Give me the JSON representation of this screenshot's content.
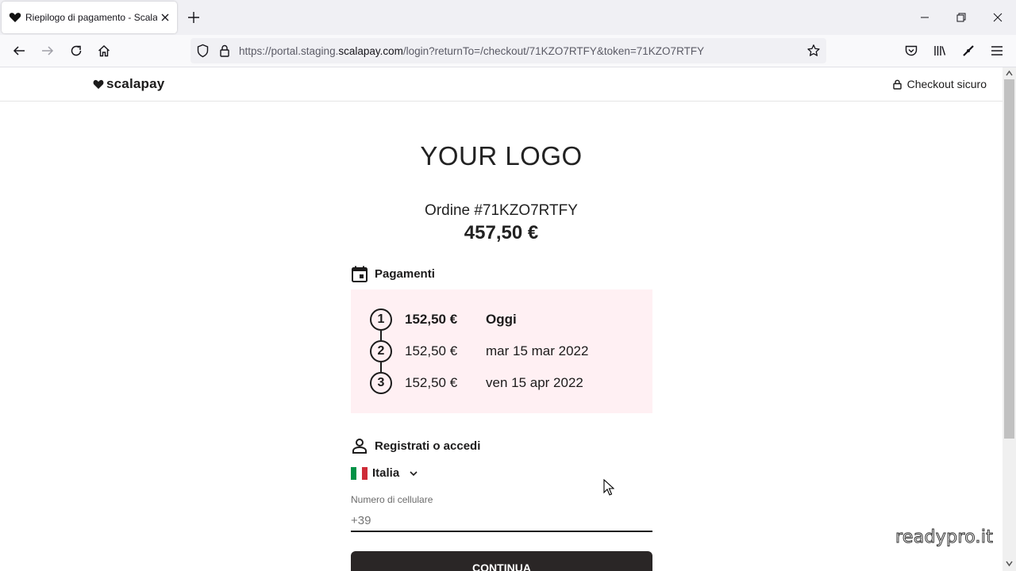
{
  "browser": {
    "tab_title": "Riepilogo di pagamento - Scalapay",
    "url_prefix": "https://portal.staging.",
    "url_host": "scalapay.com",
    "url_path": "/login?returnTo=/checkout/71KZO7RTFY&token=71KZO7RTFY"
  },
  "header": {
    "brand": "scalapay",
    "secure_label": "Checkout sicuro"
  },
  "merchant": {
    "logo_text": "YOUR LOGO"
  },
  "order": {
    "label": "Ordine #71KZO7RTFY",
    "total": "457,50 €"
  },
  "payments": {
    "title": "Pagamenti",
    "installments": [
      {
        "number": "1",
        "amount": "152,50 €",
        "date": "Oggi"
      },
      {
        "number": "2",
        "amount": "152,50 €",
        "date": "mar 15 mar 2022"
      },
      {
        "number": "3",
        "amount": "152,50 €",
        "date": "ven 15 apr 2022"
      }
    ]
  },
  "login": {
    "title": "Registrati o accedi",
    "country": "Italia",
    "phone_label": "Numero di cellulare",
    "phone_placeholder": "+39",
    "continue_label": "CONTINUA"
  },
  "watermark": "readypro.it",
  "colors": {
    "accent_pink": "#fff0f3",
    "dark": "#2a2626",
    "flag_green": "#009246",
    "flag_red": "#ce2b37"
  }
}
